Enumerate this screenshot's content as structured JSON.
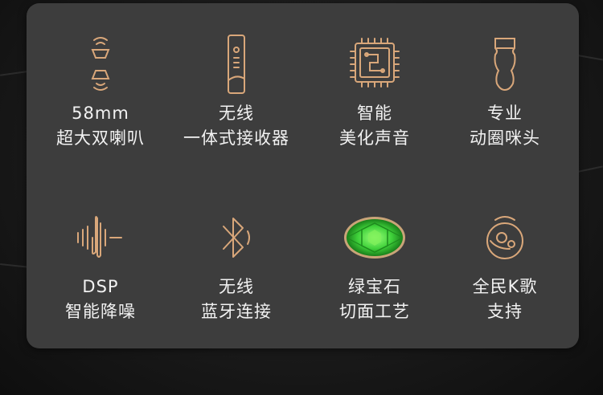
{
  "colors": {
    "accent": "#d9a77a",
    "panel": "#3d3d3d",
    "text": "#f2f2f2",
    "gem": "#3fd13a"
  },
  "features": [
    {
      "icon": "speaker-icon",
      "line1": "58mm",
      "line2": "超大双喇叭"
    },
    {
      "icon": "receiver-icon",
      "line1": "无线",
      "line2": "一体式接收器"
    },
    {
      "icon": "chip-icon",
      "line1": "智能",
      "line2": "美化声音"
    },
    {
      "icon": "microphone-capsule-icon",
      "line1": "专业",
      "line2": "动圈咪头"
    },
    {
      "icon": "soundwave-icon",
      "line1": "DSP",
      "line2": "智能降噪"
    },
    {
      "icon": "bluetooth-icon",
      "line1": "无线",
      "line2": "蓝牙连接"
    },
    {
      "icon": "emerald-icon",
      "line1": "绿宝石",
      "line2": "切面工艺"
    },
    {
      "icon": "karaoke-icon",
      "line1": "全民K歌",
      "line2": "支持"
    }
  ]
}
